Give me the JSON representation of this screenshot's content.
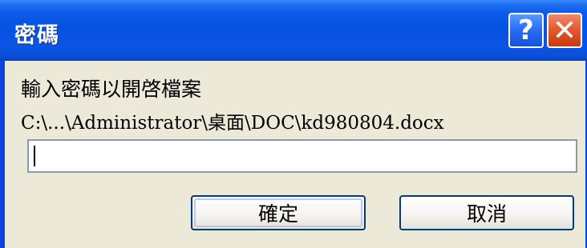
{
  "dialog": {
    "title": "密碼",
    "help_glyph": "?",
    "close_glyph": "✕",
    "prompt": "輸入密碼以開啓檔案",
    "file_path": "C:\\...\\Administrator\\桌面\\DOC\\kd980804.docx",
    "password_value": "",
    "ok_label": "確定",
    "cancel_label": "取消"
  },
  "colors": {
    "titlebar": "#0752e0",
    "client_bg": "#ece9d8",
    "close_button": "#e55b30",
    "input_border": "#7f9db9"
  },
  "icons": {
    "help": "help-icon",
    "close": "close-icon"
  }
}
